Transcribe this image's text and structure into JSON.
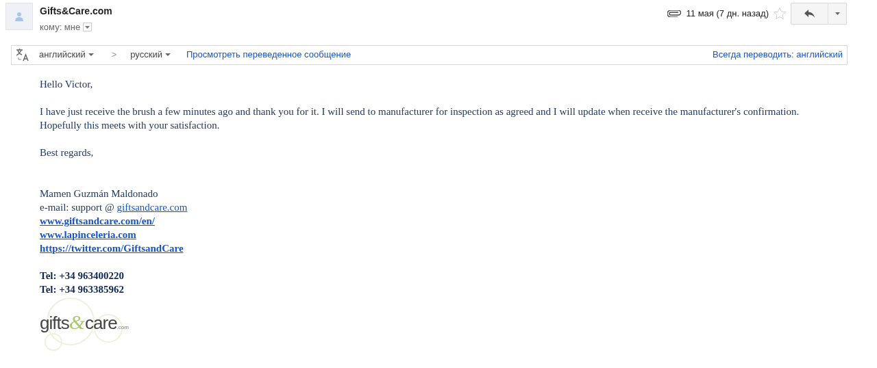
{
  "header": {
    "sender": "Gifts&Care.com",
    "recipient": "кому: мне",
    "date": "11 мая (7 дн. назад)",
    "has_attachment": true,
    "starred": false
  },
  "translate_bar": {
    "source_language": "английский",
    "separator": ">",
    "target_language": "русский",
    "view_link": "Просмотреть переведенное сообщение",
    "always_link": "Всегда переводить: английский"
  },
  "body": {
    "paragraphs": [
      "Hello Victor,",
      "I have just receive the brush a few minutes ago and thank you for it. I will send to manufacturer for inspection as agreed and I will update when receive the manufacturer's confirmation.\nHopefully this meets with your satisfaction.",
      "Best regards,"
    ]
  },
  "signature": {
    "name": "Mamen Guzmán Maldonado",
    "email_label": "e-mail: support @ ",
    "email_link": "giftsandcare.com",
    "links": [
      "www.giftsandcare.com/en/",
      "www.lapinceleria.com",
      "https://twitter.com/GiftsandCare"
    ],
    "phones": [
      "Tel: +34 963400220",
      "Tel: +34 963385962"
    ],
    "logo": {
      "word1": "gifts",
      "amp": "&",
      "word2": "care",
      "suffix": ".com"
    }
  }
}
